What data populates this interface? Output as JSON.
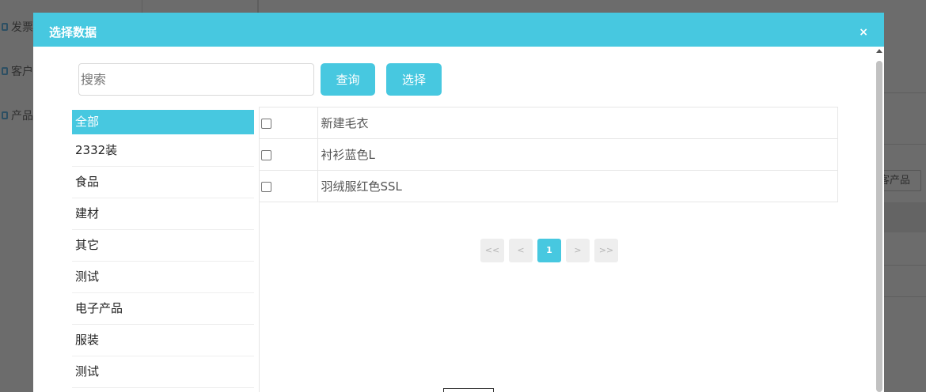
{
  "background": {
    "sidebar_items": [
      {
        "label": "发票"
      },
      {
        "label": "客户"
      },
      {
        "label": "产品"
      }
    ],
    "right_button_label": "客产品"
  },
  "modal": {
    "title": "选择数据",
    "close_label": "×",
    "search": {
      "placeholder": "搜索",
      "value": ""
    },
    "query_button": "查询",
    "select_button": "选择",
    "categories": [
      {
        "label": "全部",
        "active": true
      },
      {
        "label": "2332装"
      },
      {
        "label": "食品"
      },
      {
        "label": "建材"
      },
      {
        "label": "其它"
      },
      {
        "label": "测试"
      },
      {
        "label": "电子产品"
      },
      {
        "label": "服装"
      },
      {
        "label": "测试"
      }
    ],
    "rows": [
      {
        "name": "新建毛衣",
        "checked": false
      },
      {
        "name": "衬衫蓝色L",
        "checked": false
      },
      {
        "name": "羽绒服红色SSL",
        "checked": false
      }
    ],
    "pagination": {
      "first": "<<",
      "prev": "<",
      "current": "1",
      "next": ">",
      "last": ">>"
    }
  },
  "colors": {
    "accent": "#47c8e0",
    "overlay": "#6c6c6c"
  }
}
